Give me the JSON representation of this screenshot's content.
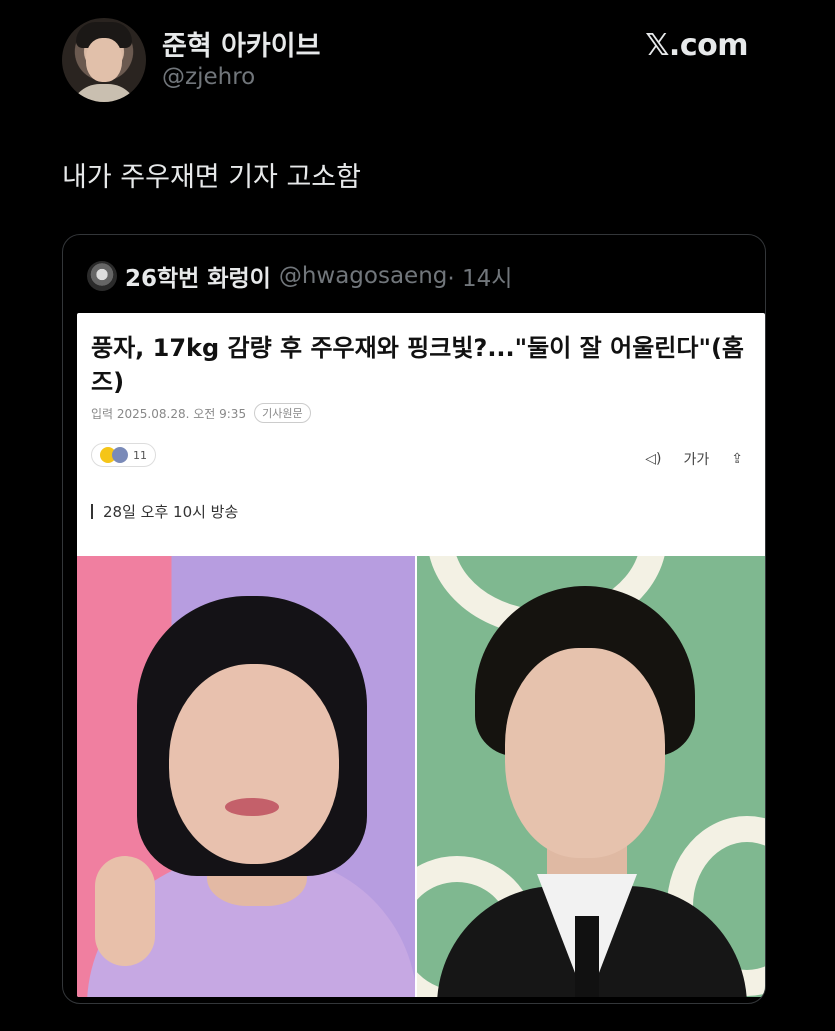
{
  "header": {
    "display_name": "준혁 아카이브",
    "handle": "@zjehro",
    "site": "𝕏.com"
  },
  "tweet": {
    "text": "내가 주우재면 기자 고소함"
  },
  "quote": {
    "name": "26학번 화렁이",
    "handle": "@hwagosaeng",
    "time": "· 14시",
    "article": {
      "title": "풍자, 17kg 감량 후 주우재와 핑크빛?...\"둘이 잘 어울린다\"(홈즈)",
      "meta_date": "입력 2025.08.28. 오전 9:35",
      "meta_badge": "기사원문",
      "reaction_count": "11",
      "tool_audio": "◁)",
      "tool_font": "가가",
      "tool_share": "⇪",
      "subhead": "28일 오후 10시 방송"
    }
  }
}
